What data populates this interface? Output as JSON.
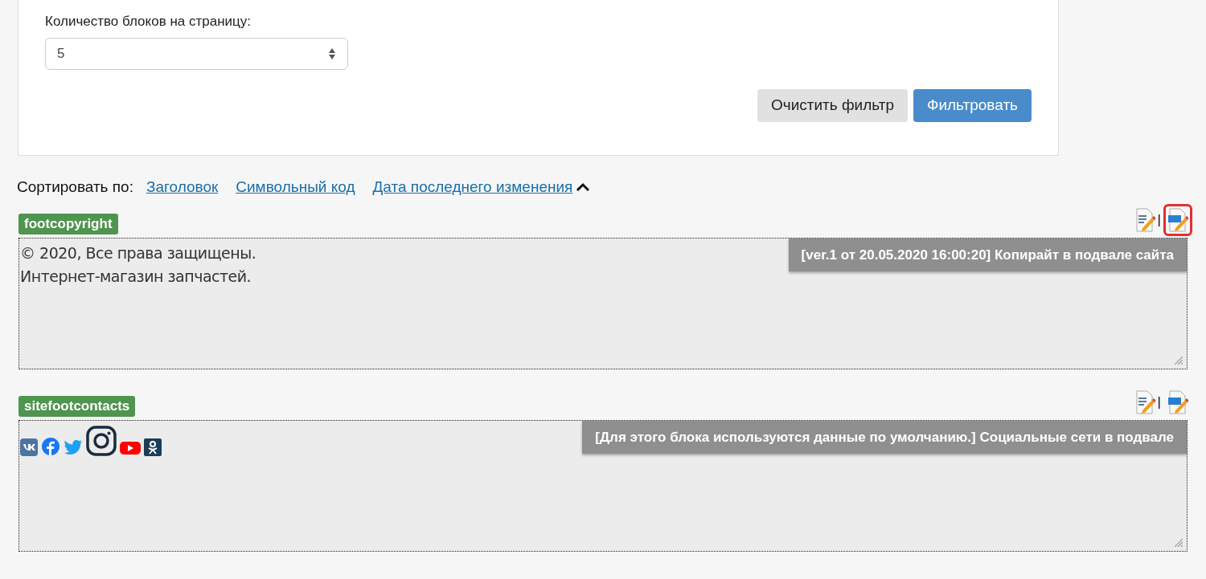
{
  "filter": {
    "per_page_label": "Количество блоков на страницу:",
    "per_page_value": "5",
    "buttons": [
      {
        "kind": "secondary",
        "label": "Очистить фильтр"
      },
      {
        "kind": "primary",
        "label": "Фильтровать"
      }
    ]
  },
  "sort": {
    "label": "Сортировать по:",
    "links": [
      {
        "kind": "link",
        "label": "Заголовок"
      },
      {
        "kind": "link",
        "label": "Символьный код"
      },
      {
        "kind": "link",
        "label": "Дата последнего изменения"
      },
      {
        "kind": "indicator",
        "ascending": true
      }
    ]
  },
  "blocks": [
    {
      "code": "footcopyright",
      "separator": "|",
      "html_icon_highlighted": true,
      "kind": "text",
      "lines": [
        "© 2020, Все права защищены.",
        "Интернет-магазин запчастей."
      ],
      "caption": "[ver.1 от 20.05.2020 16:00:20] Копирайт в подвале сайта"
    },
    {
      "code": "sitefootcontacts",
      "separator": "|",
      "html_icon_highlighted": false,
      "kind": "social",
      "caption": "[Для этого блока используются данные по умолчанию.] Социальные сети в подвале"
    }
  ]
}
